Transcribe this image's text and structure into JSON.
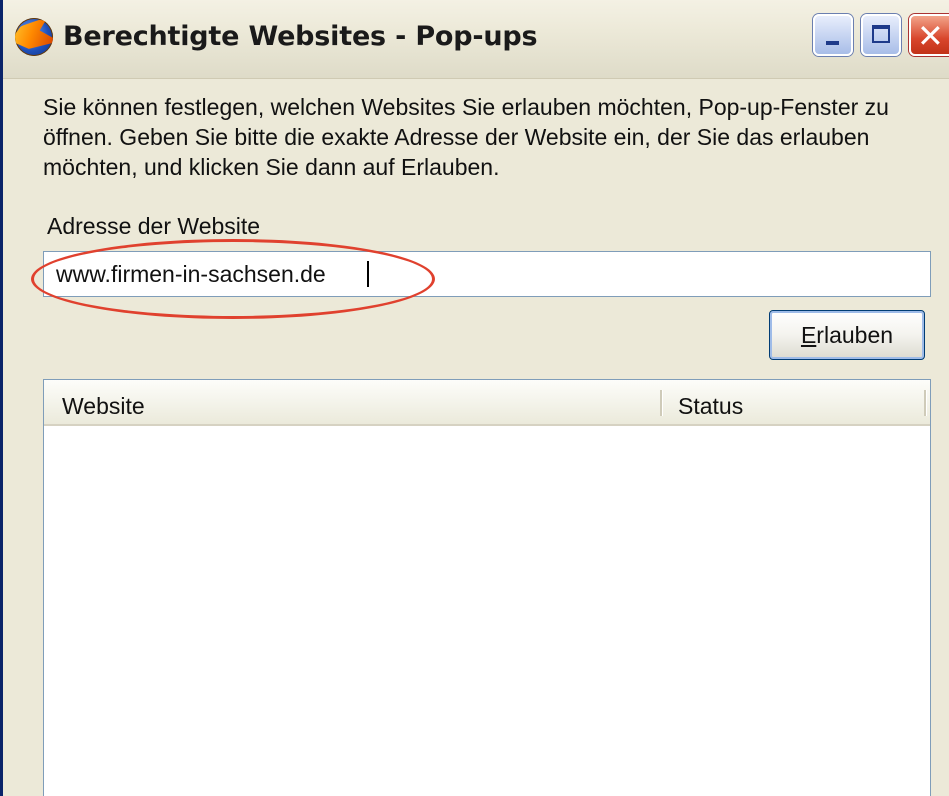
{
  "window": {
    "title": "Berechtigte Websites - Pop-ups",
    "icon": "firefox-icon",
    "controls": {
      "minimize": "minimize-icon",
      "maximize": "maximize-icon",
      "close": "✕"
    }
  },
  "description": "Sie können festlegen, welchen Websites Sie erlauben möchten, Pop-up-Fenster zu öffnen. Geben Sie bitte die exakte Adresse der Website ein, der Sie das erlauben möchten, und klicken Sie dann auf Erlauben.",
  "address": {
    "label": "Adresse der Website",
    "value": "www.firmen-in-sachsen.de"
  },
  "allow_button": {
    "label_first": "E",
    "label_rest": "rlauben"
  },
  "site_list": {
    "columns": [
      "Website",
      "Status"
    ],
    "rows": []
  },
  "colors": {
    "highlight": "#e0412e",
    "window_bg": "#ece9d8"
  }
}
